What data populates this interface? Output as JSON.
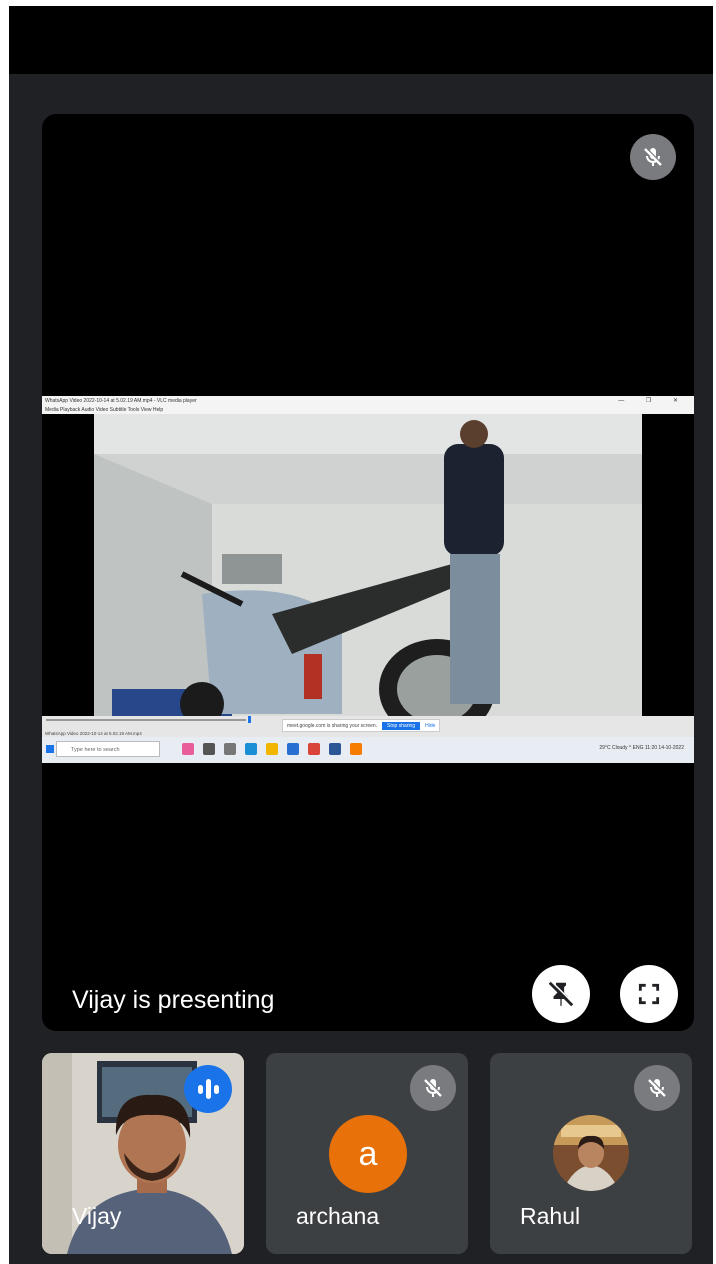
{
  "presentation": {
    "presenting_label": "Vijay is presenting"
  },
  "shared_window": {
    "window_title": "WhatsApp Video 2022-10-14 at 5.02.19 AM.mp4 - VLC media player",
    "menu": "Media  Playback  Audio  Video  Subtitle  Tools  View  Help",
    "window_controls": "— ❐ ✕",
    "share_banner_text": "meet.google.com is sharing your screen.",
    "stop_sharing_label": "Stop sharing",
    "hide_label": "Hide",
    "file_name": "WhatsApp Video 2022-10-14 at 5.02.19 AM.mp4",
    "taskbar_search_placeholder": "Type here to search",
    "tray_text": "29°C Cloudy  ^ ENG  11:20  14-10-2022"
  },
  "participants": [
    {
      "name": "Vijay",
      "speaking": true
    },
    {
      "name": "archana",
      "avatar_letter": "a",
      "muted": true
    },
    {
      "name": "Rahul",
      "muted": true
    }
  ],
  "colors": {
    "background": "#202124",
    "tile": "#3c4043",
    "accent_blue": "#1a73e8",
    "avatar_orange": "#e8710a"
  }
}
